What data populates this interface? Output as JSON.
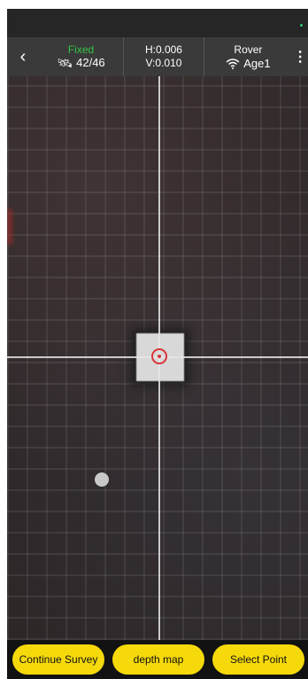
{
  "status_bar": {
    "indicator_color": "#2ecc71"
  },
  "toolbar": {
    "back_icon": "chevron-left-icon",
    "fix_status": "Fixed",
    "fix_color": "#35c447",
    "satellites": "42/46",
    "satellite_icon": "satellite-icon",
    "h_precision": "H:0.006",
    "v_precision": "V:0.010",
    "mode": "Rover",
    "age": "Age1",
    "signal_icon": "wifi-icon",
    "menu_icon": "more-vertical-icon"
  },
  "map": {
    "crosshair_color": "#e6e6e6",
    "target_color": "#d9343a"
  },
  "actions": {
    "continue_survey": "Continue Survey",
    "depth_map": "depth map",
    "select_point": "Select Point",
    "button_color": "#f5d90a"
  }
}
